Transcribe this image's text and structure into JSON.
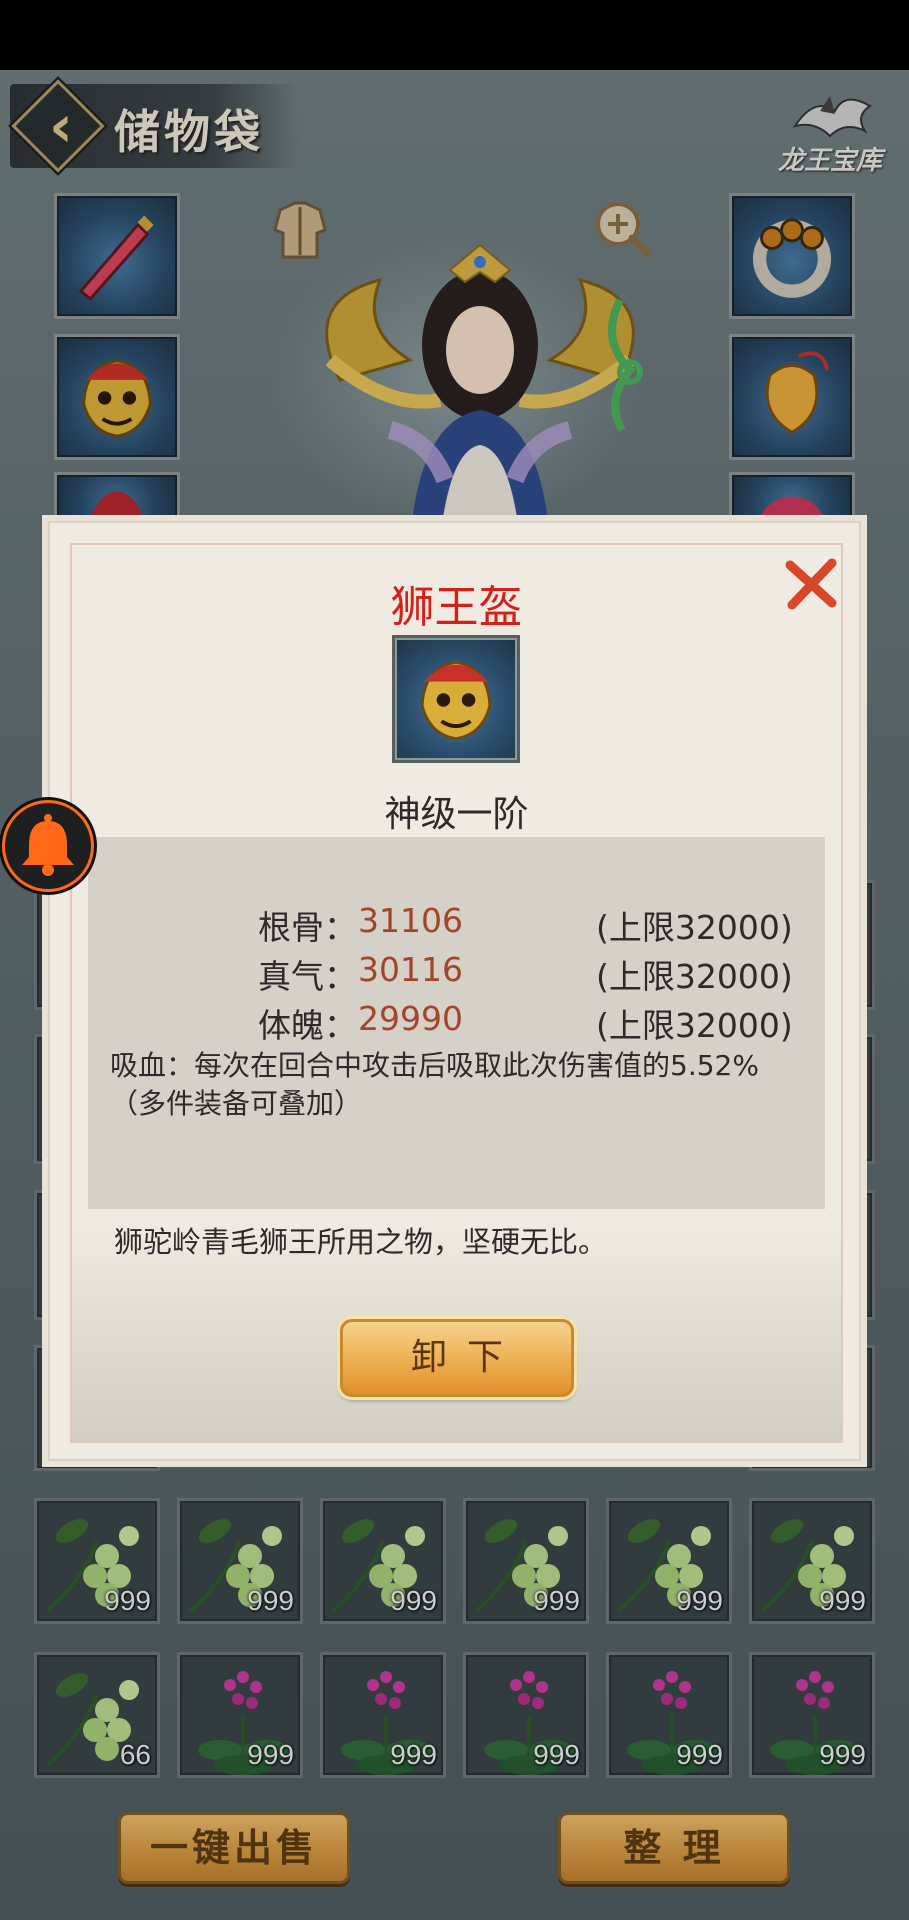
{
  "header": {
    "title": "储物袋",
    "treasury_label": "龙王宝库"
  },
  "modal": {
    "item_name": "狮王盔",
    "grade": "神级一阶",
    "stats": [
      {
        "label": "根骨：",
        "value": "31106",
        "cap": "(上限32000)"
      },
      {
        "label": "真气：",
        "value": "30116",
        "cap": "(上限32000)"
      },
      {
        "label": "体魄：",
        "value": "29990",
        "cap": "(上限32000)"
      }
    ],
    "lifesteal_line1": "吸血：每次在回合中攻击后吸取此次伤害值的5.52%",
    "lifesteal_line2": "（多件装备可叠加）",
    "description": "狮驼岭青毛狮王所用之物，坚硬无比。",
    "unequip_label": "卸下"
  },
  "inventory": {
    "row1": [
      "999",
      "999",
      "999",
      "999",
      "999",
      "999"
    ],
    "row2": [
      "66",
      "999",
      "999",
      "999",
      "999",
      "999"
    ]
  },
  "bottom": {
    "sell_all_label": "一键出售",
    "sort_label": "整 理"
  },
  "colors": {
    "item_name": "#d4201a",
    "stat_value": "#a0462a",
    "accent_gold": "#e0902b",
    "bell_ring": "#ff6a1a"
  }
}
